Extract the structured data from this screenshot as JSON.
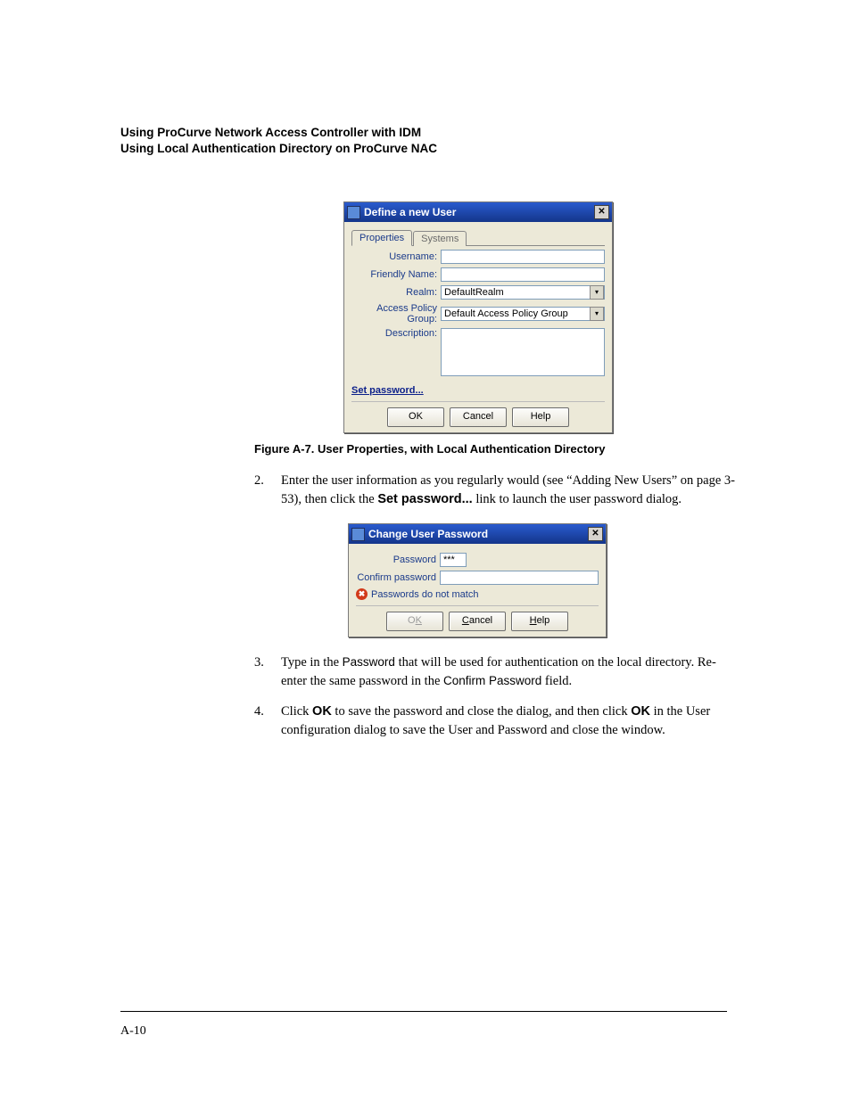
{
  "header": {
    "line1": "Using ProCurve Network Access Controller with IDM",
    "line2": "Using Local Authentication Directory on ProCurve NAC"
  },
  "dialog1": {
    "title": "Define a new User",
    "tabs": {
      "properties": "Properties",
      "systems": "Systems"
    },
    "labels": {
      "username": "Username:",
      "friendly": "Friendly Name:",
      "realm": "Realm:",
      "apg": "Access Policy Group:",
      "desc": "Description:"
    },
    "values": {
      "username": "",
      "friendly": "",
      "realm": "DefaultRealm",
      "apg": "Default Access Policy Group",
      "desc": ""
    },
    "set_password": "Set password...",
    "buttons": {
      "ok": "OK",
      "cancel": "Cancel",
      "help": "Help"
    }
  },
  "caption1": "Figure A-7. User Properties, with Local Authentication Directory",
  "step2": {
    "num": "2.",
    "pre": "Enter the user information as you regularly would (see “Adding New Users” on page 3-53), then click the ",
    "bold": "Set password...",
    "post": " link to launch the user password dialog."
  },
  "dialog2": {
    "title": "Change User Password",
    "labels": {
      "password": "Password",
      "confirm": "Confirm password"
    },
    "values": {
      "password": "***",
      "confirm": ""
    },
    "error": "Passwords do not match",
    "buttons": {
      "ok_pre": "O",
      "ok_u": "K",
      "cancel_u": "C",
      "cancel_post": "ancel",
      "help_u": "H",
      "help_post": "elp"
    }
  },
  "step3": {
    "num": "3.",
    "t1": "Type in the ",
    "code1": "Password",
    "t2": " that will be used for authentication on the local directory. Re-enter the same password in the ",
    "code2": "Confirm Password",
    "t3": " field."
  },
  "step4": {
    "num": "4.",
    "t1": "Click ",
    "ok1": "OK",
    "t2": " to save the password and close the dialog, and then click ",
    "ok2": "OK",
    "t3": " in the User configuration dialog to save the User and Password and close the window."
  },
  "page_number": "A-10"
}
